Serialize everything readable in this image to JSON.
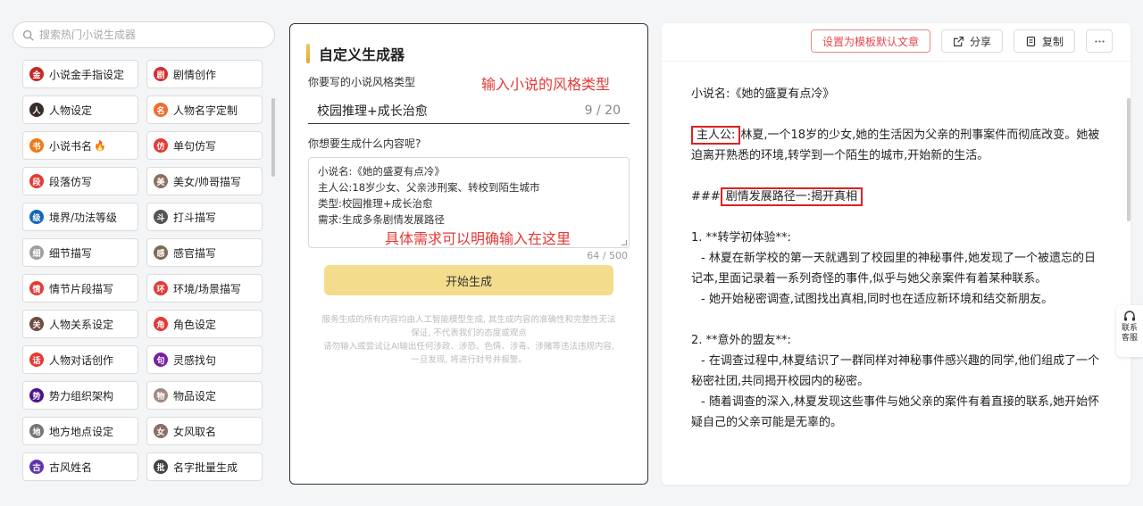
{
  "search": {
    "placeholder": "搜索热门小说生成器"
  },
  "tools": [
    {
      "label": "小说金手指设定",
      "icon": "golden-finger-icon",
      "color": "#c62828",
      "glyph": "金"
    },
    {
      "label": "剧情创作",
      "icon": "plot-icon",
      "color": "#d32f2f",
      "glyph": "剧"
    },
    {
      "label": "人物设定",
      "icon": "character-avatar-icon",
      "color": "#3a2b2b",
      "glyph": "人"
    },
    {
      "label": "人物名字定制",
      "icon": "name-icon",
      "color": "#ef6c2e",
      "glyph": "名"
    },
    {
      "label": "小说书名",
      "icon": "book-title-icon",
      "color": "#f07a1a",
      "glyph": "书",
      "hot": "🔥"
    },
    {
      "label": "单句仿写",
      "icon": "sentence-icon",
      "color": "#e53935",
      "glyph": "仿"
    },
    {
      "label": "段落仿写",
      "icon": "paragraph-icon",
      "color": "#e53935",
      "glyph": "段"
    },
    {
      "label": "美女/帅哥描写",
      "icon": "beauty-avatar-icon",
      "color": "#8d6e63",
      "glyph": "美"
    },
    {
      "label": "境界/功法等级",
      "icon": "realm-icon",
      "color": "#1565c0",
      "glyph": "级"
    },
    {
      "label": "打斗描写",
      "icon": "fight-icon",
      "color": "#555555",
      "glyph": "斗"
    },
    {
      "label": "细节描写",
      "icon": "magnifier-icon",
      "color": "#9e9e9e",
      "glyph": "细"
    },
    {
      "label": "感官描写",
      "icon": "sense-avatar-icon",
      "color": "#7e6b55",
      "glyph": "感"
    },
    {
      "label": "情节片段描写",
      "icon": "scene-fragment-icon",
      "color": "#e53935",
      "glyph": "情"
    },
    {
      "label": "环境/场景描写",
      "icon": "environment-icon",
      "color": "#e53935",
      "glyph": "环"
    },
    {
      "label": "人物关系设定",
      "icon": "relation-avatar-icon",
      "color": "#6d4c41",
      "glyph": "关"
    },
    {
      "label": "角色设定",
      "icon": "role-icon",
      "color": "#e53935",
      "glyph": "角"
    },
    {
      "label": "人物对话创作",
      "icon": "dialogue-icon",
      "color": "#e53935",
      "glyph": "话"
    },
    {
      "label": "灵感找句",
      "icon": "inspiration-icon",
      "color": "#7b1fa2",
      "glyph": "句"
    },
    {
      "label": "势力组织架构",
      "icon": "faction-icon",
      "color": "#4a148c",
      "glyph": "势"
    },
    {
      "label": "物品设定",
      "icon": "item-icon",
      "color": "#a1887f",
      "glyph": "物"
    },
    {
      "label": "地方地点设定",
      "icon": "location-icon",
      "color": "#757575",
      "glyph": "地"
    },
    {
      "label": "女风取名",
      "icon": "female-name-avatar-icon",
      "color": "#8d6e63",
      "glyph": "女"
    },
    {
      "label": "古风姓名",
      "icon": "ancient-name-icon",
      "color": "#5e35b1",
      "glyph": "古"
    },
    {
      "label": "名字批量生成",
      "icon": "batch-name-icon",
      "color": "#424242",
      "glyph": "批"
    }
  ],
  "generator": {
    "title": "自定义生成器",
    "style_label": "你要写的小说风格类型",
    "style_annotation": "输入小说的风格类型",
    "style_value": "校园推理+成长治愈",
    "style_count": "9 / 20",
    "content_label": "你想要生成什么内容呢?",
    "content_lines": [
      "小说名:《她的盛夏有点冷》",
      "主人公:18岁少女、父亲涉刑案、转校到陌生城市",
      "类型:校园推理+成长治愈",
      "需求:生成多条剧情发展路径"
    ],
    "content_annotation": "具体需求可以明确输入在这里",
    "content_count": "64 / 500",
    "button_label": "开始生成",
    "disclaimer": [
      "服务生成的所有内容均由人工智能模型生成, 其生成内容的准确性和完整性无法",
      "保证, 不代表我们的态度或观点",
      "请勿输入或尝试让AI输出任何涉政、涉恐、色情、涉毒、涉赌等违法违规内容,",
      "一旦发现, 将进行封号并报警。"
    ]
  },
  "result": {
    "btn_template": "设置为模板默认文章",
    "btn_share": "分享",
    "btn_copy": "复制",
    "title_line": "小说名:《她的盛夏有点冷》",
    "protagonist_label": "主人公:",
    "protagonist_text": "林夏,一个18岁的少女,她的生活因为父亲的刑事案件而彻底改变。她被迫离开熟悉的环境,转学到一个陌生的城市,开始新的生活。",
    "heading_prefix": "###",
    "heading_text": "剧情发展路径一:揭开真相",
    "item1_title": "1. **转学初体验**:",
    "item1_a": "- 林夏在新学校的第一天就遇到了校园里的神秘事件,她发现了一个被遗忘的日记本,里面记录着一系列奇怪的事件,似乎与她父亲案件有着某种联系。",
    "item1_b": "- 她开始秘密调查,试图找出真相,同时也在适应新环境和结交新朋友。",
    "item2_title": "2. **意外的盟友**:",
    "item2_a": "- 在调查过程中,林夏结识了一群同样对神秘事件感兴趣的同学,他们组成了一个秘密社团,共同揭开校园内的秘密。",
    "item2_b": "- 随着调查的深入,林夏发现这些事件与她父亲的案件有着直接的联系,她开始怀疑自己的父亲可能是无辜的。"
  },
  "support": {
    "label": "联系客服"
  }
}
